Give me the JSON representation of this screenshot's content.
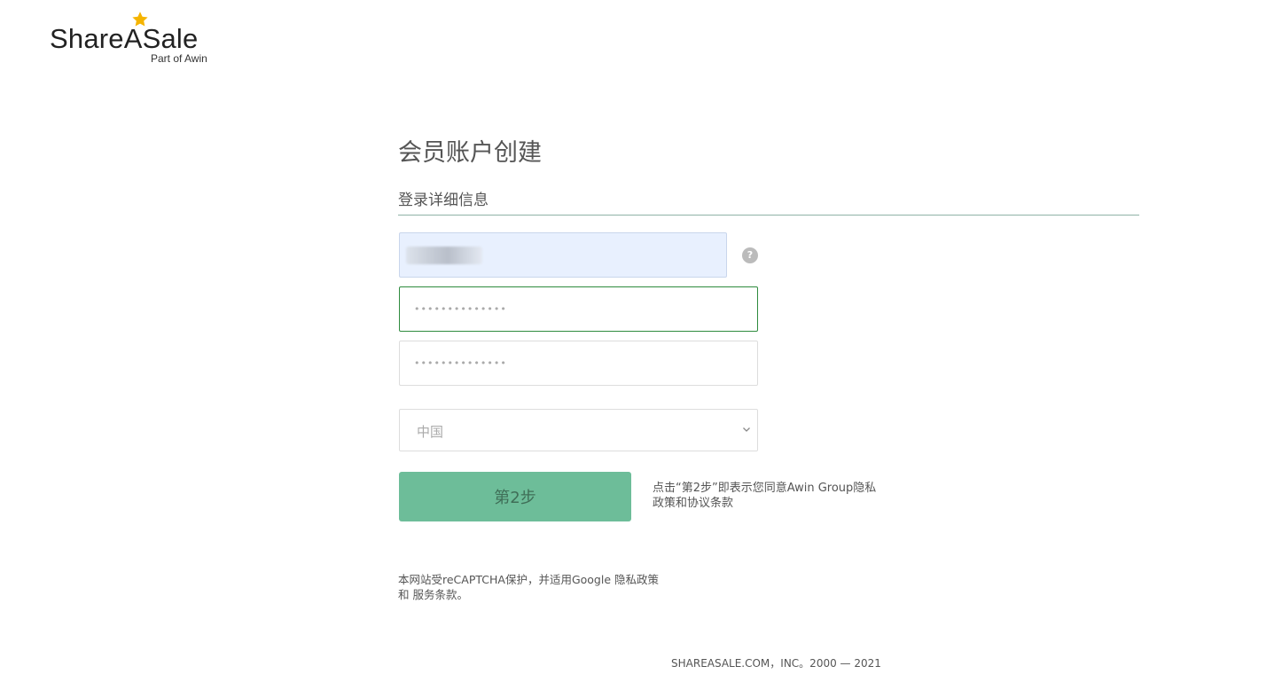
{
  "logo": {
    "brand": "ShareASale",
    "tagline": "Part of Awin"
  },
  "colors": {
    "accent_green": "#6dbd99",
    "focus_border": "#2e8b3e",
    "star": "#f5b400",
    "rule": "#8fb3a6",
    "autofill_bg": "#e8f0fe"
  },
  "page": {
    "title": "会员账户创建",
    "section_title": "登录详细信息"
  },
  "form": {
    "username_help_icon": "?",
    "password_value": "••••••••••••••",
    "confirm_value": "••••••••••••••",
    "country_selected": "中国",
    "next_button_label": "第2步",
    "agree_text": "点击“第2步”即表示您同意Awin Group隐私政策和协议条款"
  },
  "recaptcha": {
    "text": "本网站受reCAPTCHA保护，并适用Google 隐私政策和 服务条款。"
  },
  "footer": {
    "copyright": "SHAREASALE.COM，INC。2000 — 2021"
  },
  "icons": {
    "logo_star": "star-icon",
    "help": "question-mark-icon",
    "select": "chevron-down-icon"
  }
}
